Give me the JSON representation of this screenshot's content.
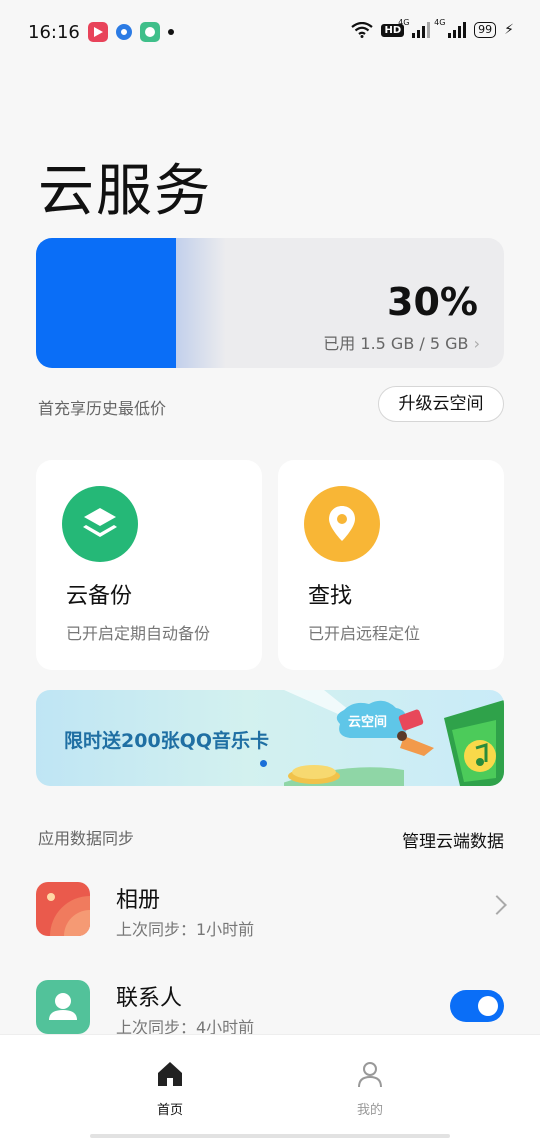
{
  "status_bar": {
    "time": "16:16",
    "network_label": "4G",
    "hd_label": "HD",
    "battery": "99"
  },
  "page": {
    "title": "云服务"
  },
  "storage": {
    "used_fraction": 0.3,
    "percent_label": "30%",
    "detail": "已用 1.5 GB / 5 GB",
    "accent_color": "#0a6ef7"
  },
  "promo": {
    "text": "首充享历史最低价",
    "upgrade_label": "升级云空间"
  },
  "features": [
    {
      "title": "云备份",
      "subtitle": "已开启定期自动备份",
      "icon": "layers-icon",
      "color": "#25b877"
    },
    {
      "title": "查找",
      "subtitle": "已开启远程定位",
      "icon": "location-pin-icon",
      "color": "#f8b636"
    }
  ],
  "banner": {
    "text": "限时送200张QQ音乐卡",
    "badge_text": "云空间"
  },
  "sync": {
    "section_label": "应用数据同步",
    "manage_label": "管理云端数据",
    "items": [
      {
        "title": "相册",
        "subtitle": "上次同步：1小时前",
        "icon": "album-icon",
        "control": "chevron"
      },
      {
        "title": "联系人",
        "subtitle": "上次同步：4小时前",
        "icon": "contacts-icon",
        "control": "toggle",
        "enabled": true
      }
    ]
  },
  "bottom_nav": [
    {
      "label": "首页",
      "icon": "home-icon",
      "active": true
    },
    {
      "label": "我的",
      "icon": "person-icon",
      "active": false
    }
  ]
}
